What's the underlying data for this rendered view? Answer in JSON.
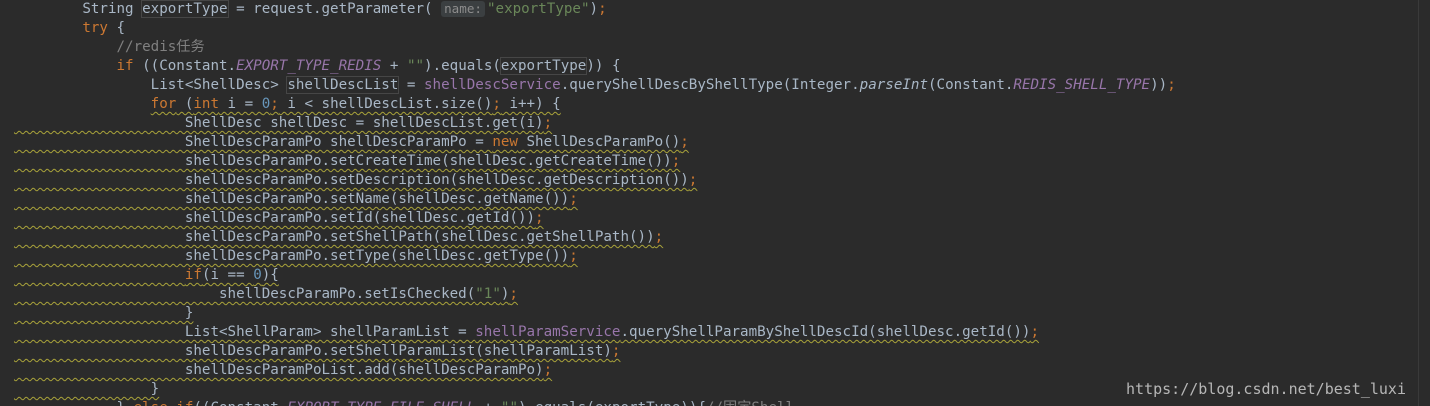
{
  "editor": {
    "language": "java",
    "theme": "darcula",
    "colors": {
      "background": "#2b2b2b",
      "text": "#a9b7c6",
      "keyword": "#cc7832",
      "comment": "#808080",
      "string": "#6a8759",
      "number": "#6897bb",
      "field": "#9876aa",
      "warning_underline": "#a9a33a"
    },
    "lines": [
      "        String exportType = request.getParameter( name: \"exportType\");",
      "        try {",
      "            //redis任务",
      "            if ((Constant.EXPORT_TYPE_REDIS + \"\").equals(exportType)) {",
      "                List<ShellDesc> shellDescList = shellDescService.queryShellDescByShellType(Integer.parseInt(Constant.REDIS_SHELL_TYPE));",
      "                for (int i = 0; i < shellDescList.size(); i++) {",
      "                    ShellDesc shellDesc = shellDescList.get(i);",
      "                    ShellDescParamPo shellDescParamPo = new ShellDescParamPo();",
      "                    shellDescParamPo.setCreateTime(shellDesc.getCreateTime());",
      "                    shellDescParamPo.setDescription(shellDesc.getDescription());",
      "                    shellDescParamPo.setName(shellDesc.getName());",
      "                    shellDescParamPo.setId(shellDesc.getId());",
      "                    shellDescParamPo.setShellPath(shellDesc.getShellPath());",
      "                    shellDescParamPo.setType(shellDesc.getType());",
      "                    if(i == 0){",
      "                        shellDescParamPo.setIsChecked(\"1\");",
      "                    }",
      "                    List<ShellParam> shellParamList = shellParamService.queryShellParamByShellDescId(shellDesc.getId());",
      "                    shellDescParamPo.setShellParamList(shellParamList);",
      "                    shellDescParamPoList.add(shellDescParamPo);",
      "                }",
      "            } else if((Constant.EXPORT_TYPE_FILE_SHELL + \"\").equals(exportType)){//固定Shell"
    ],
    "param_hint": "name:"
  },
  "watermark": "https://blog.csdn.net/best_luxi"
}
